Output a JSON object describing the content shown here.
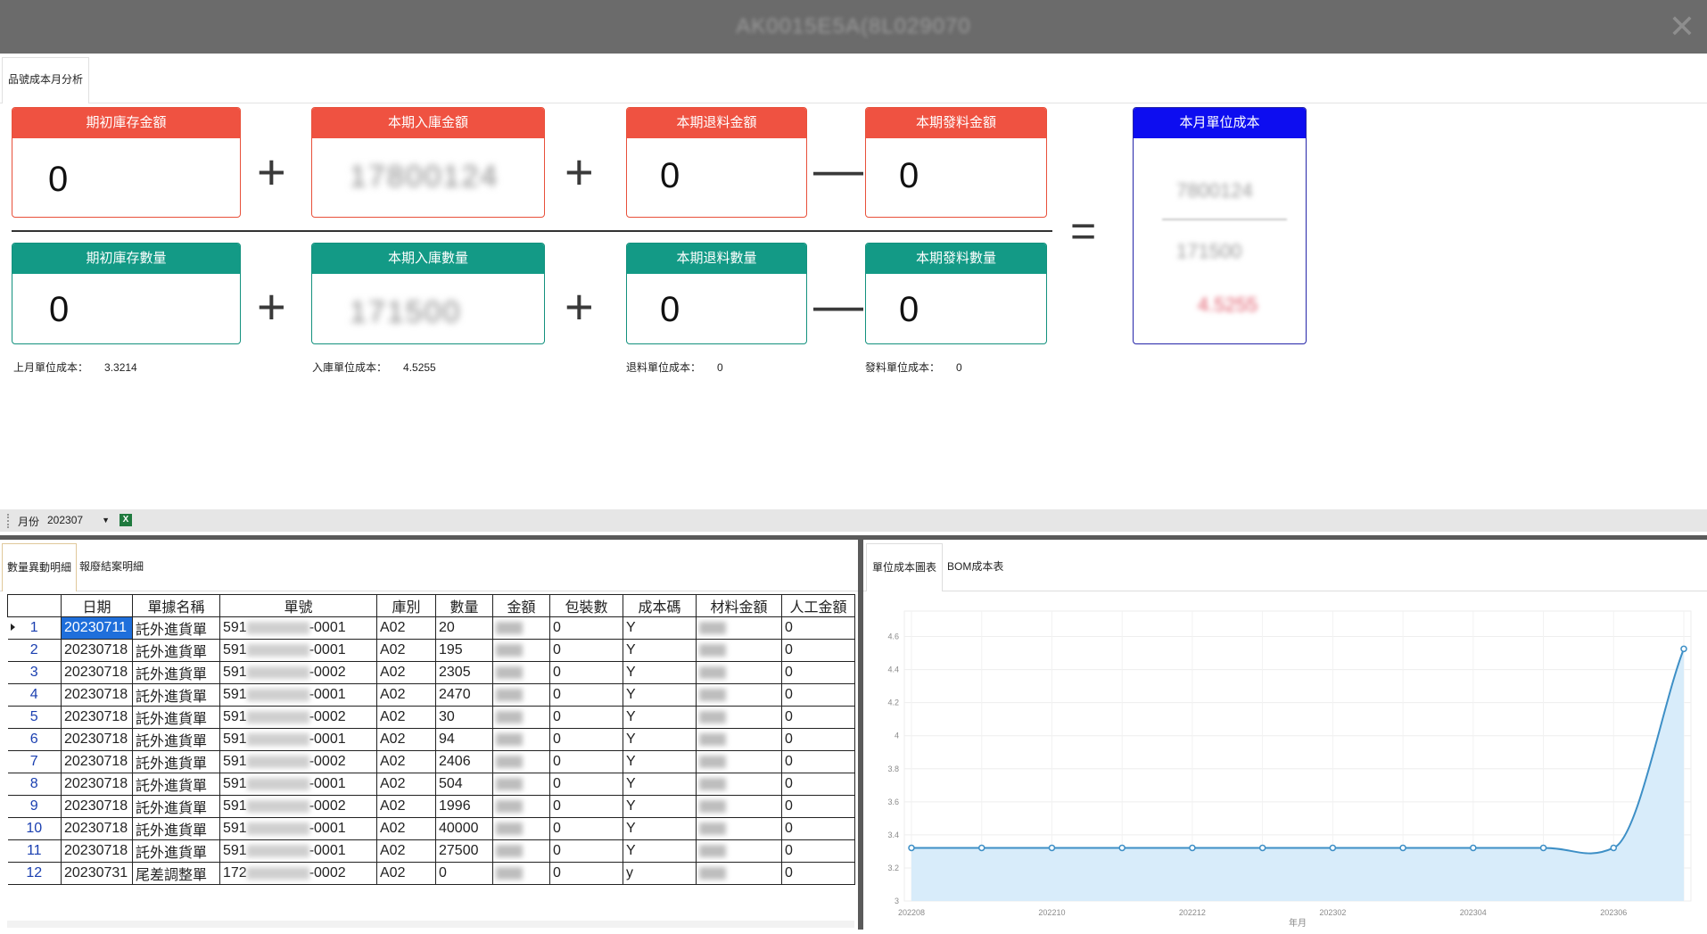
{
  "window": {
    "title": "AK0015E5A(8L029070",
    "close_icon": "close-icon"
  },
  "tabs": {
    "top": "品號成本月分析"
  },
  "formula": {
    "top": [
      {
        "label": "期初庫存金額",
        "value": "0"
      },
      {
        "label": "本期入庫金額",
        "value": "17800124"
      },
      {
        "label": "本期退料金額",
        "value": "0"
      },
      {
        "label": "本期發料金額",
        "value": "0"
      }
    ],
    "bottom": [
      {
        "label": "期初庫存數量",
        "value": "0"
      },
      {
        "label": "本期入庫數量",
        "value": "171500"
      },
      {
        "label": "本期退料數量",
        "value": "0"
      },
      {
        "label": "本期發料數量",
        "value": "0"
      }
    ],
    "ops": {
      "plus": "+",
      "minus": "—",
      "equals": "="
    },
    "result": {
      "label": "本月單位成本",
      "numerator": "7800124",
      "denominator": "171500",
      "value": "4.5255"
    },
    "notes": [
      {
        "label": "上月單位成本：",
        "value": "3.3214"
      },
      {
        "label": "入庫單位成本：",
        "value": "4.5255"
      },
      {
        "label": "退料單位成本：",
        "value": "0"
      },
      {
        "label": "發料單位成本：",
        "value": "0"
      }
    ]
  },
  "toolbar": {
    "month_label": "月份",
    "month_value": "202307",
    "excel_icon": "excel-icon"
  },
  "left_tabs": [
    "數量異動明細",
    "報廢結案明細"
  ],
  "right_tabs": [
    "單位成本圖表",
    "BOM成本表"
  ],
  "table": {
    "headers": [
      "日期",
      "單據名稱",
      "單號",
      "庫別",
      "數量",
      "金額",
      "包裝數",
      "成本碼",
      "材料金額",
      "人工金額"
    ],
    "rows": [
      {
        "n": "1",
        "date": "20230711",
        "name": "託外進貨單",
        "pre": "591",
        "suf": "-0001",
        "wh": "A02",
        "qty": "20",
        "pack": "0",
        "code": "Y",
        "labor": "0"
      },
      {
        "n": "2",
        "date": "20230718",
        "name": "託外進貨單",
        "pre": "591",
        "suf": "-0001",
        "wh": "A02",
        "qty": "195",
        "pack": "0",
        "code": "Y",
        "labor": "0"
      },
      {
        "n": "3",
        "date": "20230718",
        "name": "託外進貨單",
        "pre": "591",
        "suf": "-0002",
        "wh": "A02",
        "qty": "2305",
        "pack": "0",
        "code": "Y",
        "labor": "0"
      },
      {
        "n": "4",
        "date": "20230718",
        "name": "託外進貨單",
        "pre": "591",
        "suf": "-0001",
        "wh": "A02",
        "qty": "2470",
        "pack": "0",
        "code": "Y",
        "labor": "0"
      },
      {
        "n": "5",
        "date": "20230718",
        "name": "託外進貨單",
        "pre": "591",
        "suf": "-0002",
        "wh": "A02",
        "qty": "30",
        "pack": "0",
        "code": "Y",
        "labor": "0"
      },
      {
        "n": "6",
        "date": "20230718",
        "name": "託外進貨單",
        "pre": "591",
        "suf": "-0001",
        "wh": "A02",
        "qty": "94",
        "pack": "0",
        "code": "Y",
        "labor": "0"
      },
      {
        "n": "7",
        "date": "20230718",
        "name": "託外進貨單",
        "pre": "591",
        "suf": "-0002",
        "wh": "A02",
        "qty": "2406",
        "pack": "0",
        "code": "Y",
        "labor": "0"
      },
      {
        "n": "8",
        "date": "20230718",
        "name": "託外進貨單",
        "pre": "591",
        "suf": "-0001",
        "wh": "A02",
        "qty": "504",
        "pack": "0",
        "code": "Y",
        "labor": "0"
      },
      {
        "n": "9",
        "date": "20230718",
        "name": "託外進貨單",
        "pre": "591",
        "suf": "-0002",
        "wh": "A02",
        "qty": "1996",
        "pack": "0",
        "code": "Y",
        "labor": "0"
      },
      {
        "n": "10",
        "date": "20230718",
        "name": "託外進貨單",
        "pre": "591",
        "suf": "-0001",
        "wh": "A02",
        "qty": "40000",
        "pack": "0",
        "code": "Y",
        "labor": "0"
      },
      {
        "n": "11",
        "date": "20230718",
        "name": "託外進貨單",
        "pre": "591",
        "suf": "-0001",
        "wh": "A02",
        "qty": "27500",
        "pack": "0",
        "code": "Y",
        "labor": "0"
      },
      {
        "n": "12",
        "date": "20230731",
        "name": "尾差調整單",
        "pre": "172",
        "suf": "-0002",
        "wh": "A02",
        "qty": "0",
        "pack": "0",
        "code": "y",
        "labor": "0"
      }
    ]
  },
  "chart_data": {
    "type": "area",
    "xlabel": "年月",
    "ylabel": "",
    "x": [
      "202208",
      "202209",
      "202210",
      "202211",
      "202212",
      "202301",
      "202302",
      "202303",
      "202304",
      "202305",
      "202306",
      "202307"
    ],
    "x_ticks": [
      "202208",
      "202210",
      "202212",
      "202302",
      "202304",
      "202306"
    ],
    "y_ticks": [
      "3",
      "3.2",
      "3.4",
      "3.6",
      "3.8",
      "4",
      "4.2",
      "4.4",
      "4.6"
    ],
    "ylim": [
      3,
      4.7
    ],
    "series": [
      {
        "values": [
          3.3214,
          3.3214,
          3.3214,
          3.3214,
          3.3214,
          3.3214,
          3.3214,
          3.3214,
          3.3214,
          3.3214,
          3.3214,
          4.5255
        ]
      }
    ],
    "line_color": "#3d8fc6",
    "fill_color": "#d8ecfa",
    "grid": true
  }
}
